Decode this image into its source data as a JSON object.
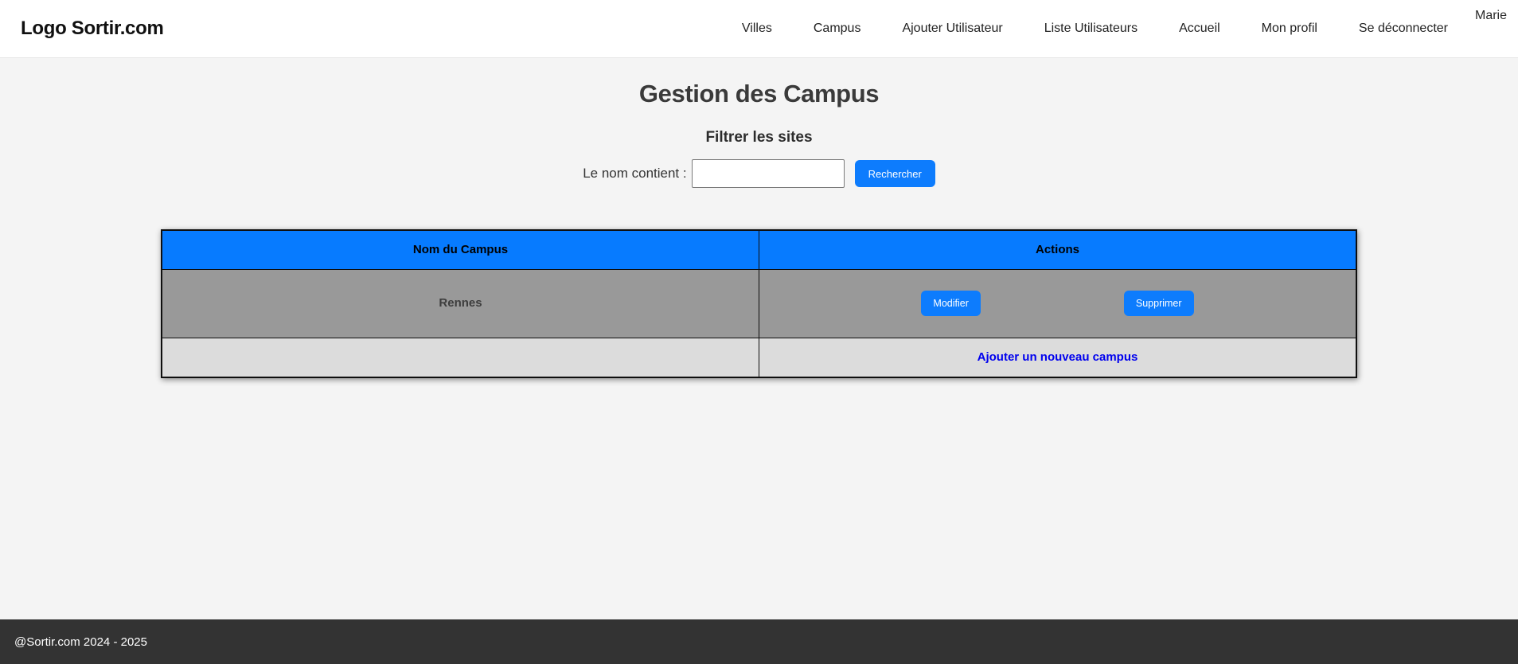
{
  "navbar": {
    "logo": "Logo Sortir.com",
    "links": [
      "Villes",
      "Campus",
      "Ajouter Utilisateur",
      "Liste Utilisateurs",
      "Accueil",
      "Mon profil",
      "Se déconnecter"
    ],
    "user": "Marie"
  },
  "main": {
    "title": "Gestion des Campus",
    "filter": {
      "heading": "Filtrer les sites",
      "label": "Le nom contient :",
      "input_value": "",
      "search_button": "Rechercher"
    },
    "table": {
      "headers": [
        "Nom du Campus",
        "Actions"
      ],
      "rows": [
        {
          "name": "Rennes",
          "actions": [
            "Modifier",
            "Supprimer"
          ]
        }
      ],
      "add_link": "Ajouter un nouveau campus"
    }
  },
  "footer": {
    "copyright": "@Sortir.com 2024 - 2025"
  },
  "colors": {
    "table_header_blue": "#077bff",
    "button_blue": "#0d7cfd",
    "data_row_gray": "#999999",
    "footer_row_gray": "#dcdcdc",
    "footer_bar_dark": "#333333",
    "link_blue": "#0000ee",
    "page_background": "#f4f4f4"
  }
}
